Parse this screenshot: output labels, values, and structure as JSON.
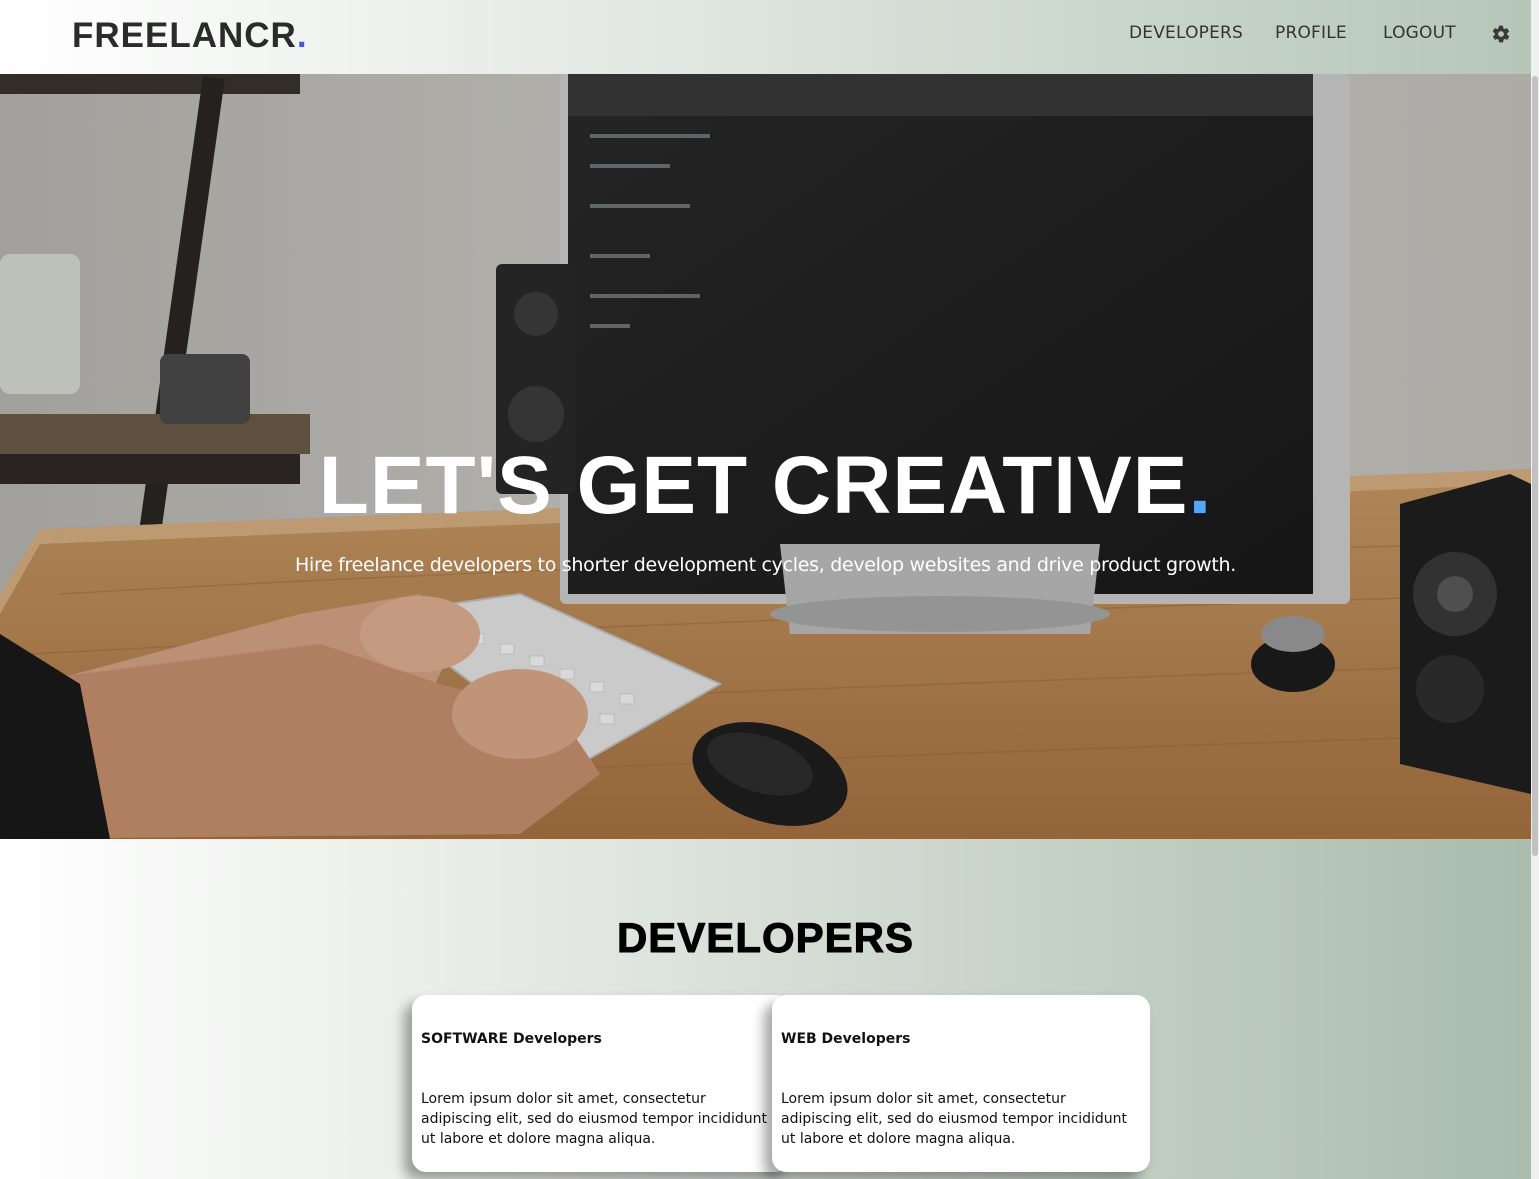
{
  "header": {
    "logo_text": "FREELANCR",
    "logo_dot": ".",
    "nav": {
      "developers": "DEVELOPERS",
      "profile": "PROFILE",
      "logout": "LOGOUT"
    },
    "settings_icon": "gear-icon"
  },
  "hero": {
    "title": "LET'S GET CREATIVE",
    "title_dot": ".",
    "subtitle": "Hire freelance developers to shorter development cycles, develop websites and drive product growth."
  },
  "developers": {
    "heading": "DEVELOPERS",
    "cards": [
      {
        "title": "SOFTWARE Developers",
        "text": "Lorem ipsum dolor sit amet, consectetur adipiscing elit, sed do eiusmod tempor incididunt ut labore et dolore magna aliqua."
      },
      {
        "title": "WEB Developers",
        "text": "Lorem ipsum dolor sit amet, consectetur adipiscing elit, sed do eiusmod tempor incididunt ut labore et dolore magna aliqua."
      }
    ]
  },
  "colors": {
    "logo_dot": "#4a56d8",
    "title_dot": "#55a6ff",
    "text_dark": "#333333"
  }
}
